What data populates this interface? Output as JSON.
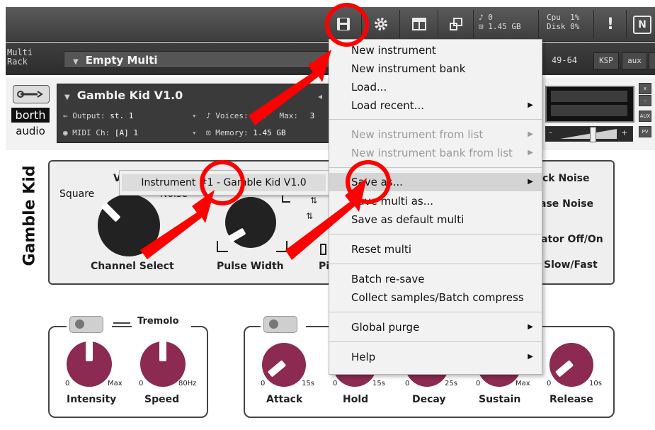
{
  "topbar": {
    "voices": "0",
    "memory": "1.45 GB",
    "cpu_label": "Cpu",
    "cpu_value": "1%",
    "disk_label": "Disk",
    "disk_value": "0%",
    "warning": "!",
    "ni_logo": "N"
  },
  "rack": {
    "label_line1": "Multi",
    "label_line2": "Rack",
    "multi_name": "Empty Multi",
    "range": "49-64",
    "ksp": "KSP",
    "aux": "aux"
  },
  "instrument": {
    "name": "Gamble Kid V1.0",
    "output_label": "Output:",
    "output_value": "st. 1",
    "voices_label": "Voices:",
    "voices_value": "0",
    "max_label": "Max:",
    "max_value": "3",
    "midi_label": "MIDI Ch:",
    "midi_value": "[A] 1",
    "memory_label": "Memory:",
    "memory_value": "1.45 GB",
    "logo_top": "borth",
    "logo_bottom": "audio",
    "side_buttons": [
      "x",
      "–",
      "AUX",
      "PV"
    ]
  },
  "panel": {
    "brand": "Gamble Kid",
    "square": "Square",
    "noise": "Noise",
    "channel_select": "Channel Select",
    "pulse_width": "Pulse Width",
    "pi_partial": "Pi",
    "right_labels": [
      "ck Noise",
      "ase Noise",
      "ator Off/On",
      "Slow/Fast"
    ],
    "w_partial": "V"
  },
  "tremolo": {
    "title": "Tremolo",
    "knobs": [
      {
        "label": "Intensity",
        "min": "0",
        "max": "Max"
      },
      {
        "label": "Speed",
        "min": "0",
        "max": "80Hz"
      }
    ]
  },
  "envelope": {
    "knobs": [
      {
        "label": "Attack",
        "min": "0",
        "max": "15s"
      },
      {
        "label": "Hold",
        "min": "0",
        "max": "15s"
      },
      {
        "label": "Decay",
        "min": "0",
        "max": "25s"
      },
      {
        "label": "Sustain",
        "min": "0",
        "max": "Max"
      },
      {
        "label": "Release",
        "min": "0",
        "max": "10s"
      }
    ]
  },
  "popup": {
    "item": "Instrument #1 - Gamble Kid V1.0"
  },
  "menu": {
    "items": [
      {
        "label": "New instrument",
        "disabled": false,
        "submenu": false
      },
      {
        "label": "New instrument bank",
        "disabled": false,
        "submenu": false
      },
      {
        "label": "Load...",
        "disabled": false,
        "submenu": false
      },
      {
        "label": "Load recent...",
        "disabled": false,
        "submenu": true
      },
      {
        "label": "New instrument from list",
        "disabled": true,
        "submenu": true
      },
      {
        "label": "New instrument bank from list",
        "disabled": true,
        "submenu": true
      },
      {
        "label": "Save as...",
        "disabled": false,
        "submenu": true,
        "highlighted": true
      },
      {
        "label": "Save multi as...",
        "disabled": false,
        "submenu": false
      },
      {
        "label": "Save as default multi",
        "disabled": false,
        "submenu": false
      },
      {
        "label": "Reset multi",
        "disabled": false,
        "submenu": false
      },
      {
        "label": "Batch re-save",
        "disabled": false,
        "submenu": false
      },
      {
        "label": "Collect samples/Batch compress",
        "disabled": false,
        "submenu": false
      },
      {
        "label": "Global purge",
        "disabled": false,
        "submenu": true
      },
      {
        "label": "Help",
        "disabled": false,
        "submenu": true
      }
    ]
  },
  "colors": {
    "annotation": "#ff0000",
    "knob_red": "#8c2a52",
    "knob_dark": "#222222"
  }
}
